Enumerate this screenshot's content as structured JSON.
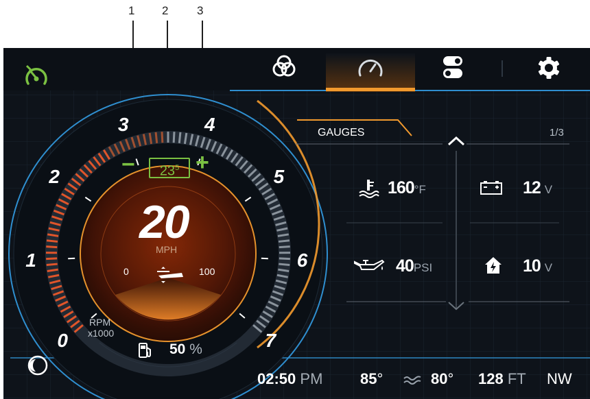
{
  "callouts": [
    "1",
    "2",
    "3"
  ],
  "top_nav": {
    "tabs": [
      {
        "icon": "color-palette-icon",
        "active": false
      },
      {
        "icon": "speedometer-icon",
        "active": true
      },
      {
        "icon": "toggle-switches-icon",
        "active": false
      },
      {
        "icon": "gear-icon",
        "active": false
      }
    ]
  },
  "cruise_icon": "cruise-control-icon",
  "night_mode_icon": "night-mode-icon",
  "tachometer": {
    "scale_labels": [
      "0",
      "1",
      "2",
      "3",
      "4",
      "5",
      "6",
      "7"
    ],
    "unit_line1": "RPM",
    "unit_line2": "x1000"
  },
  "speed_set": {
    "minus_label": "−",
    "plus_label": "+",
    "value_main": "23",
    "value_decimal": "5"
  },
  "speed": {
    "value": "20",
    "unit": "MPH"
  },
  "trim": {
    "min_label": "0",
    "max_label": "100",
    "icon": "boat-trim-icon"
  },
  "fuel": {
    "value": "50",
    "unit": "%",
    "icon": "fuel-pump-icon"
  },
  "gauges_panel": {
    "title": "GAUGES",
    "page": "1/3",
    "up_icon": "chevron-up-icon",
    "down_icon": "chevron-down-icon",
    "items": [
      {
        "icon": "water-temperature-icon",
        "value": "160",
        "unit": "°F"
      },
      {
        "icon": "battery-icon",
        "value": "12",
        "unit": "V"
      },
      {
        "icon": "oil-pressure-icon",
        "value": "40",
        "unit": "PSI"
      },
      {
        "icon": "house-battery-icon",
        "value": "10",
        "unit": "V"
      }
    ]
  },
  "status_bar": {
    "time": "02:50",
    "ampm": "PM",
    "air_temp": "85",
    "air_temp_unit": "°",
    "water_temp": "80",
    "water_temp_unit": "°",
    "water_icon": "water-waves-icon",
    "depth": "128",
    "depth_unit": "FT",
    "heading": "NW"
  },
  "colors": {
    "accent_orange": "#f29a2e",
    "accent_blue": "#2f8fd0",
    "accent_green": "#7bc142",
    "background": "#0e131a"
  }
}
